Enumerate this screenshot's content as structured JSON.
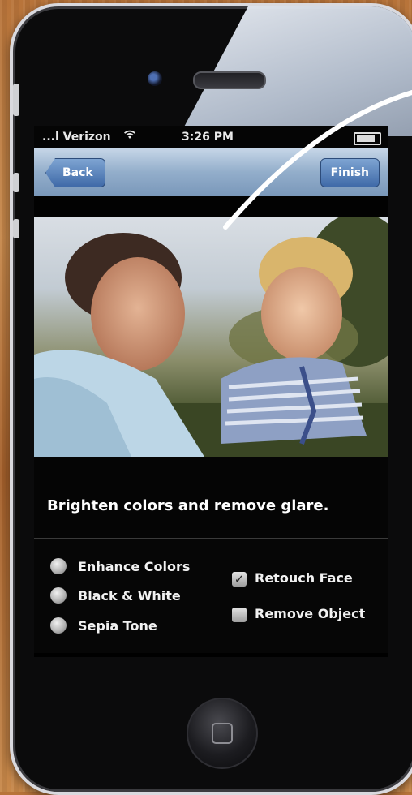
{
  "status_bar": {
    "carrier": "...l Verizon",
    "wifi": "wifi-icon",
    "time": "3:26 PM",
    "battery": "battery-icon"
  },
  "navbar": {
    "back_label": "Back",
    "finish_label": "Finish"
  },
  "photo": {
    "description_icon": "photo-image"
  },
  "caption": "Brighten colors and remove glare.",
  "options": {
    "radios": [
      {
        "label": "Enhance Colors"
      },
      {
        "label": "Black & White"
      },
      {
        "label": "Sepia Tone"
      }
    ],
    "checkboxes": [
      {
        "label": "Retouch Face",
        "checked": true,
        "mark": "✓"
      },
      {
        "label": "Remove Object",
        "checked": false,
        "mark": ""
      }
    ]
  },
  "colors": {
    "nav_accent": "#3f6aa8",
    "wood": "#c98a4c"
  }
}
